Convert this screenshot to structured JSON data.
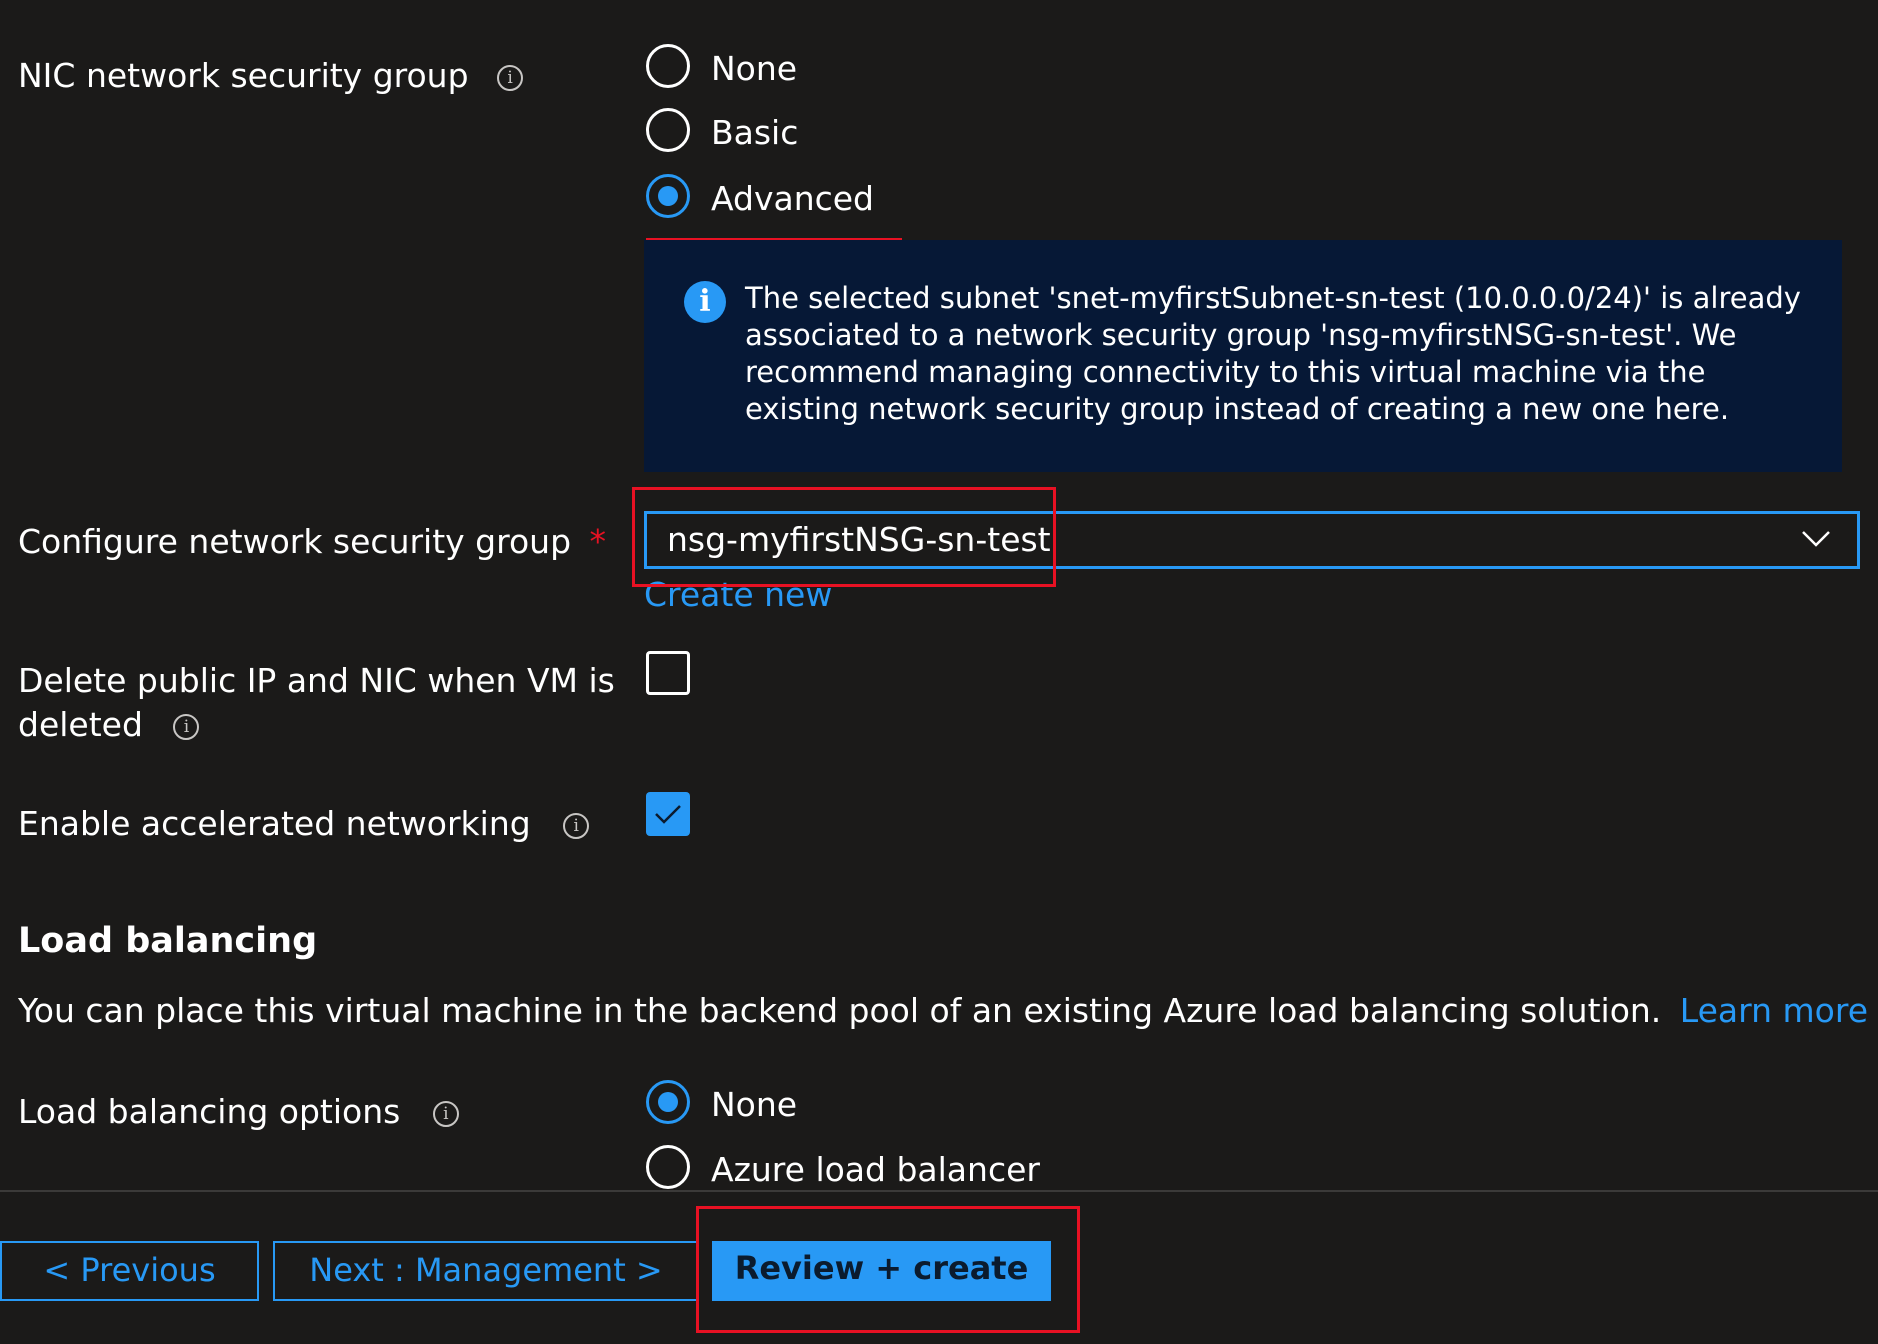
{
  "nic_nsg": {
    "label": "NIC network security group",
    "info_icon": "i",
    "options": [
      {
        "label": "None",
        "selected": false
      },
      {
        "label": "Basic",
        "selected": false
      },
      {
        "label": "Advanced",
        "selected": true
      }
    ],
    "info_message": "The selected subnet 'snet-myfirstSubnet-sn-test (10.0.0.0/24)' is already associated to a network security group 'nsg-myfirstNSG-sn-test'. We recommend managing connectivity to this virtual machine via the existing network security group instead of creating a new one here."
  },
  "configure_nsg": {
    "label": "Configure network security group",
    "required_marker": "*",
    "value": "nsg-myfirstNSG-sn-test",
    "create_new": "Create new"
  },
  "delete_public_ip": {
    "label_line1": "Delete public IP and NIC when VM is",
    "label_line2": "deleted",
    "checked": false
  },
  "accelerated_networking": {
    "label": "Enable accelerated networking",
    "checked": true
  },
  "load_balancing": {
    "title": "Load balancing",
    "description": "You can place this virtual machine in the backend pool of an existing Azure load balancing solution.",
    "learn_more": "Learn more",
    "options_label": "Load balancing options",
    "options": [
      {
        "label": "None",
        "selected": true
      },
      {
        "label": "Azure load balancer",
        "selected": false
      }
    ]
  },
  "footer": {
    "previous": "< Previous",
    "next": "Next : Management >",
    "review_create": "Review + create"
  },
  "colors": {
    "background": "#1b1a19",
    "accent": "#2899f5",
    "info_background": "#061836",
    "highlight": "#e81123"
  }
}
